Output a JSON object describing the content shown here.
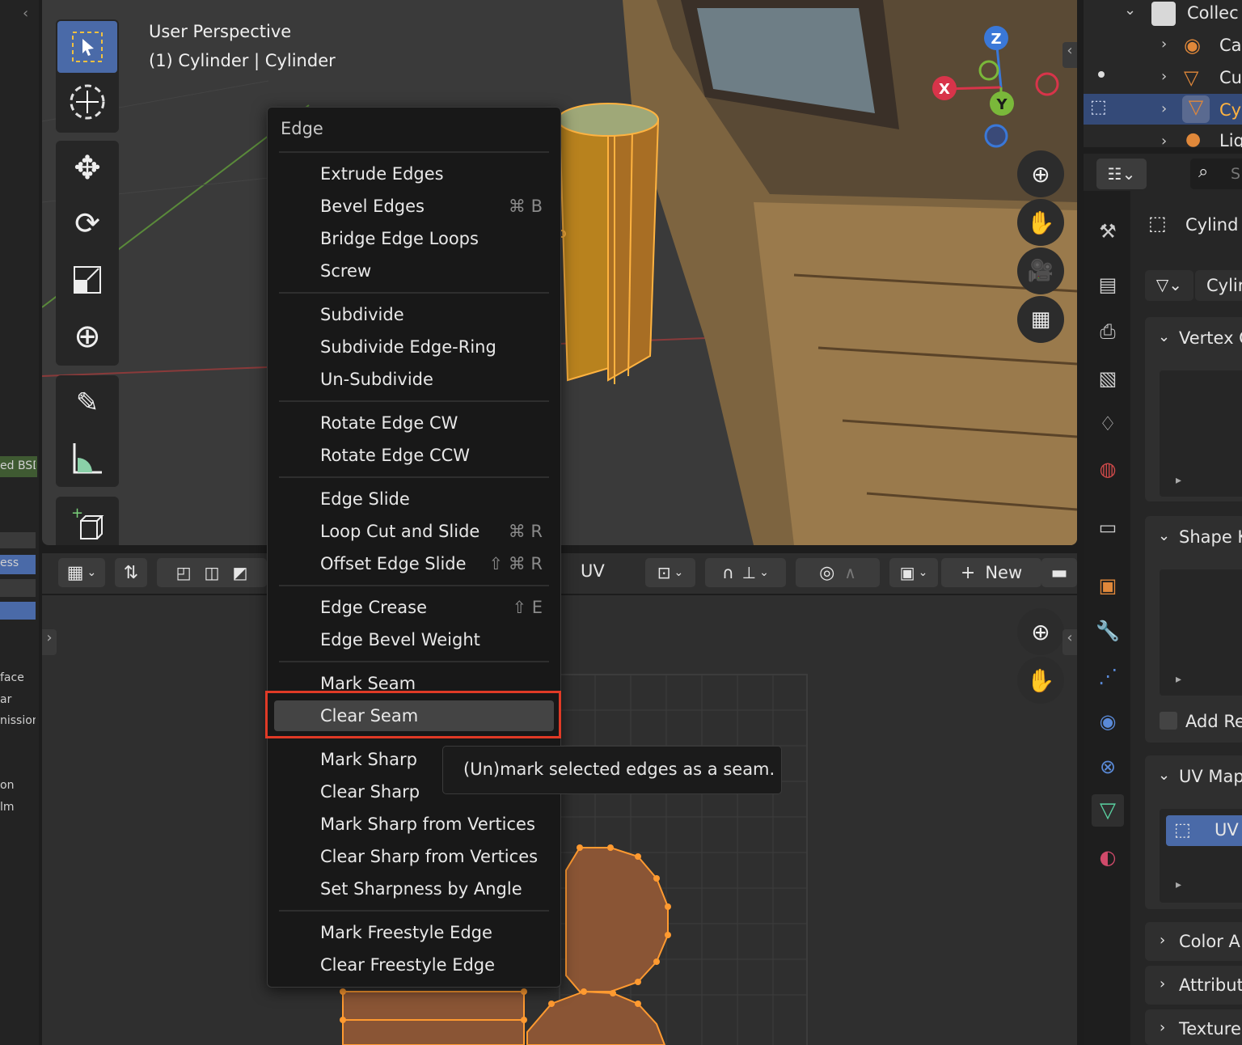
{
  "viewport": {
    "title_line1": "User Perspective",
    "title_line2": "(1) Cylinder | Cylinder",
    "gizmo": {
      "x": "X",
      "y": "Y",
      "z": "Z"
    }
  },
  "left_strip": {
    "labels": [
      "ed BSD",
      "ess",
      "face",
      "ar",
      "nission",
      "on",
      "lm"
    ]
  },
  "uv_editor": {
    "mode_label": "UV",
    "new_label": "New"
  },
  "menu": {
    "title": "Edge",
    "items": [
      {
        "label": "Extrude Edges",
        "shortcut": ""
      },
      {
        "label": "Bevel Edges",
        "shortcut": "⌘ B"
      },
      {
        "label": "Bridge Edge Loops",
        "shortcut": ""
      },
      {
        "label": "Screw",
        "shortcut": ""
      },
      {
        "label": "Subdivide",
        "shortcut": ""
      },
      {
        "label": "Subdivide Edge-Ring",
        "shortcut": ""
      },
      {
        "label": "Un-Subdivide",
        "shortcut": ""
      },
      {
        "label": "Rotate Edge CW",
        "shortcut": ""
      },
      {
        "label": "Rotate Edge CCW",
        "shortcut": ""
      },
      {
        "label": "Edge Slide",
        "shortcut": ""
      },
      {
        "label": "Loop Cut and Slide",
        "shortcut": "⌘ R"
      },
      {
        "label": "Offset Edge Slide",
        "shortcut": "⇧ ⌘ R"
      },
      {
        "label": "Edge Crease",
        "shortcut": "⇧ E"
      },
      {
        "label": "Edge Bevel Weight",
        "shortcut": ""
      },
      {
        "label": "Mark Seam",
        "shortcut": ""
      },
      {
        "label": "Clear Seam",
        "shortcut": ""
      },
      {
        "label": "Mark Sharp",
        "shortcut": ""
      },
      {
        "label": "Clear Sharp",
        "shortcut": ""
      },
      {
        "label": "Mark Sharp from Vertices",
        "shortcut": ""
      },
      {
        "label": "Clear Sharp from Vertices",
        "shortcut": ""
      },
      {
        "label": "Set Sharpness by Angle",
        "shortcut": ""
      },
      {
        "label": "Mark Freestyle Edge",
        "shortcut": ""
      },
      {
        "label": "Clear Freestyle Edge",
        "shortcut": ""
      }
    ],
    "highlighted": "Clear Seam"
  },
  "tooltip": {
    "text": "(Un)mark selected edges as a seam."
  },
  "outliner": {
    "collection": "Collec",
    "rows": [
      "Ca",
      "Cu",
      "Cy",
      "Lig"
    ]
  },
  "properties": {
    "search_placeholder": "S",
    "object_name": "Cylind",
    "mesh_name": "Cylir",
    "panels": {
      "vertex_groups": "Vertex G",
      "shape_keys": "Shape K",
      "add_rest": "Add Re",
      "uv_maps": "UV Map",
      "uv_item": "UV",
      "color_attributes": "Color A",
      "attributes": "Attribut",
      "textures": "Texture"
    }
  },
  "colors": {
    "accent": "#4a6aa8",
    "highlight_outline": "#e03a26",
    "mesh_orange": "#c88a2a",
    "uv_fill": "#8a5535"
  }
}
